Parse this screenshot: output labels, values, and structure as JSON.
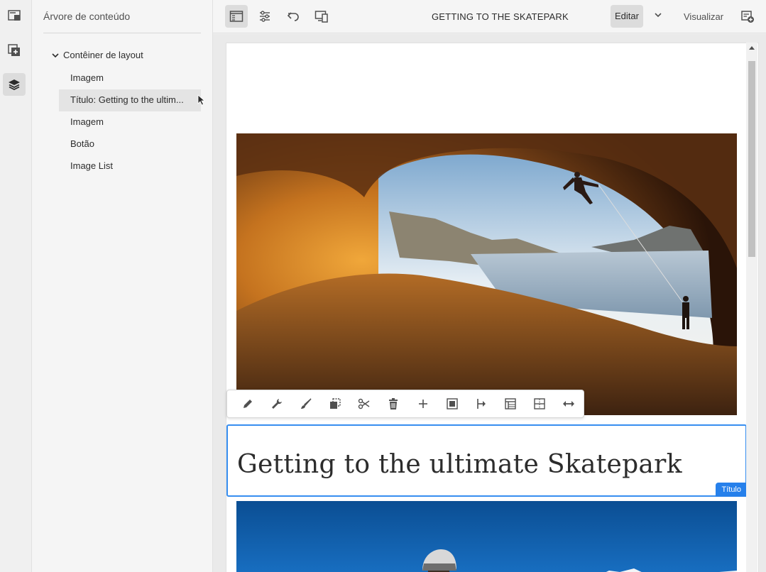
{
  "rail": {
    "icons": [
      "page-info-icon",
      "add-component-icon",
      "content-tree-icon"
    ]
  },
  "panel": {
    "title": "Árvore de conteúdo",
    "tree": {
      "root": "Contêiner de layout",
      "items": [
        {
          "label": "Imagem"
        },
        {
          "label": "Título: Getting to the ultim..."
        },
        {
          "label": "Imagem"
        },
        {
          "label": "Botão"
        },
        {
          "label": "Image List"
        }
      ]
    }
  },
  "topbar": {
    "page_name": "GETTING TO THE SKATEPARK",
    "mode": "Editar",
    "preview": "Visualizar"
  },
  "editor": {
    "title_component_text": "Getting to the ultimate Skatepark",
    "title_badge": "Título",
    "toolbar_actions": [
      "edit-icon",
      "configure-icon",
      "style-icon",
      "copy-icon",
      "cut-icon",
      "delete-icon",
      "insert-icon",
      "group-icon",
      "parent-icon",
      "layout-icon",
      "responsive-icon",
      "expand-icon"
    ]
  },
  "colors": {
    "accent": "#2680eb",
    "selection_border": "#378ef0"
  }
}
